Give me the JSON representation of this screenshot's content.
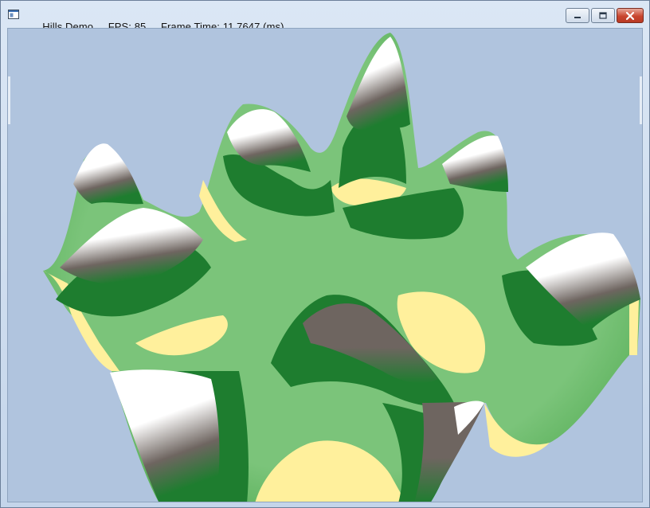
{
  "window": {
    "title": "Hills Demo",
    "fps_label": "FPS:",
    "fps_value": "85",
    "frame_time_label": "Frame Time:",
    "frame_time_value": "11.7647",
    "frame_time_unit": "(ms)",
    "controls": {
      "minimize_icon": "minimize-icon",
      "maximize_icon": "maximize-icon",
      "close_icon": "close-icon"
    }
  },
  "scene": {
    "background_color": "#b0c4de",
    "palette": {
      "snow": "#ffffff",
      "rock": "#6e6560",
      "dark_grass": "#1e7d2f",
      "light_grass": "#7bc47a",
      "sand": "#fff09c"
    }
  }
}
